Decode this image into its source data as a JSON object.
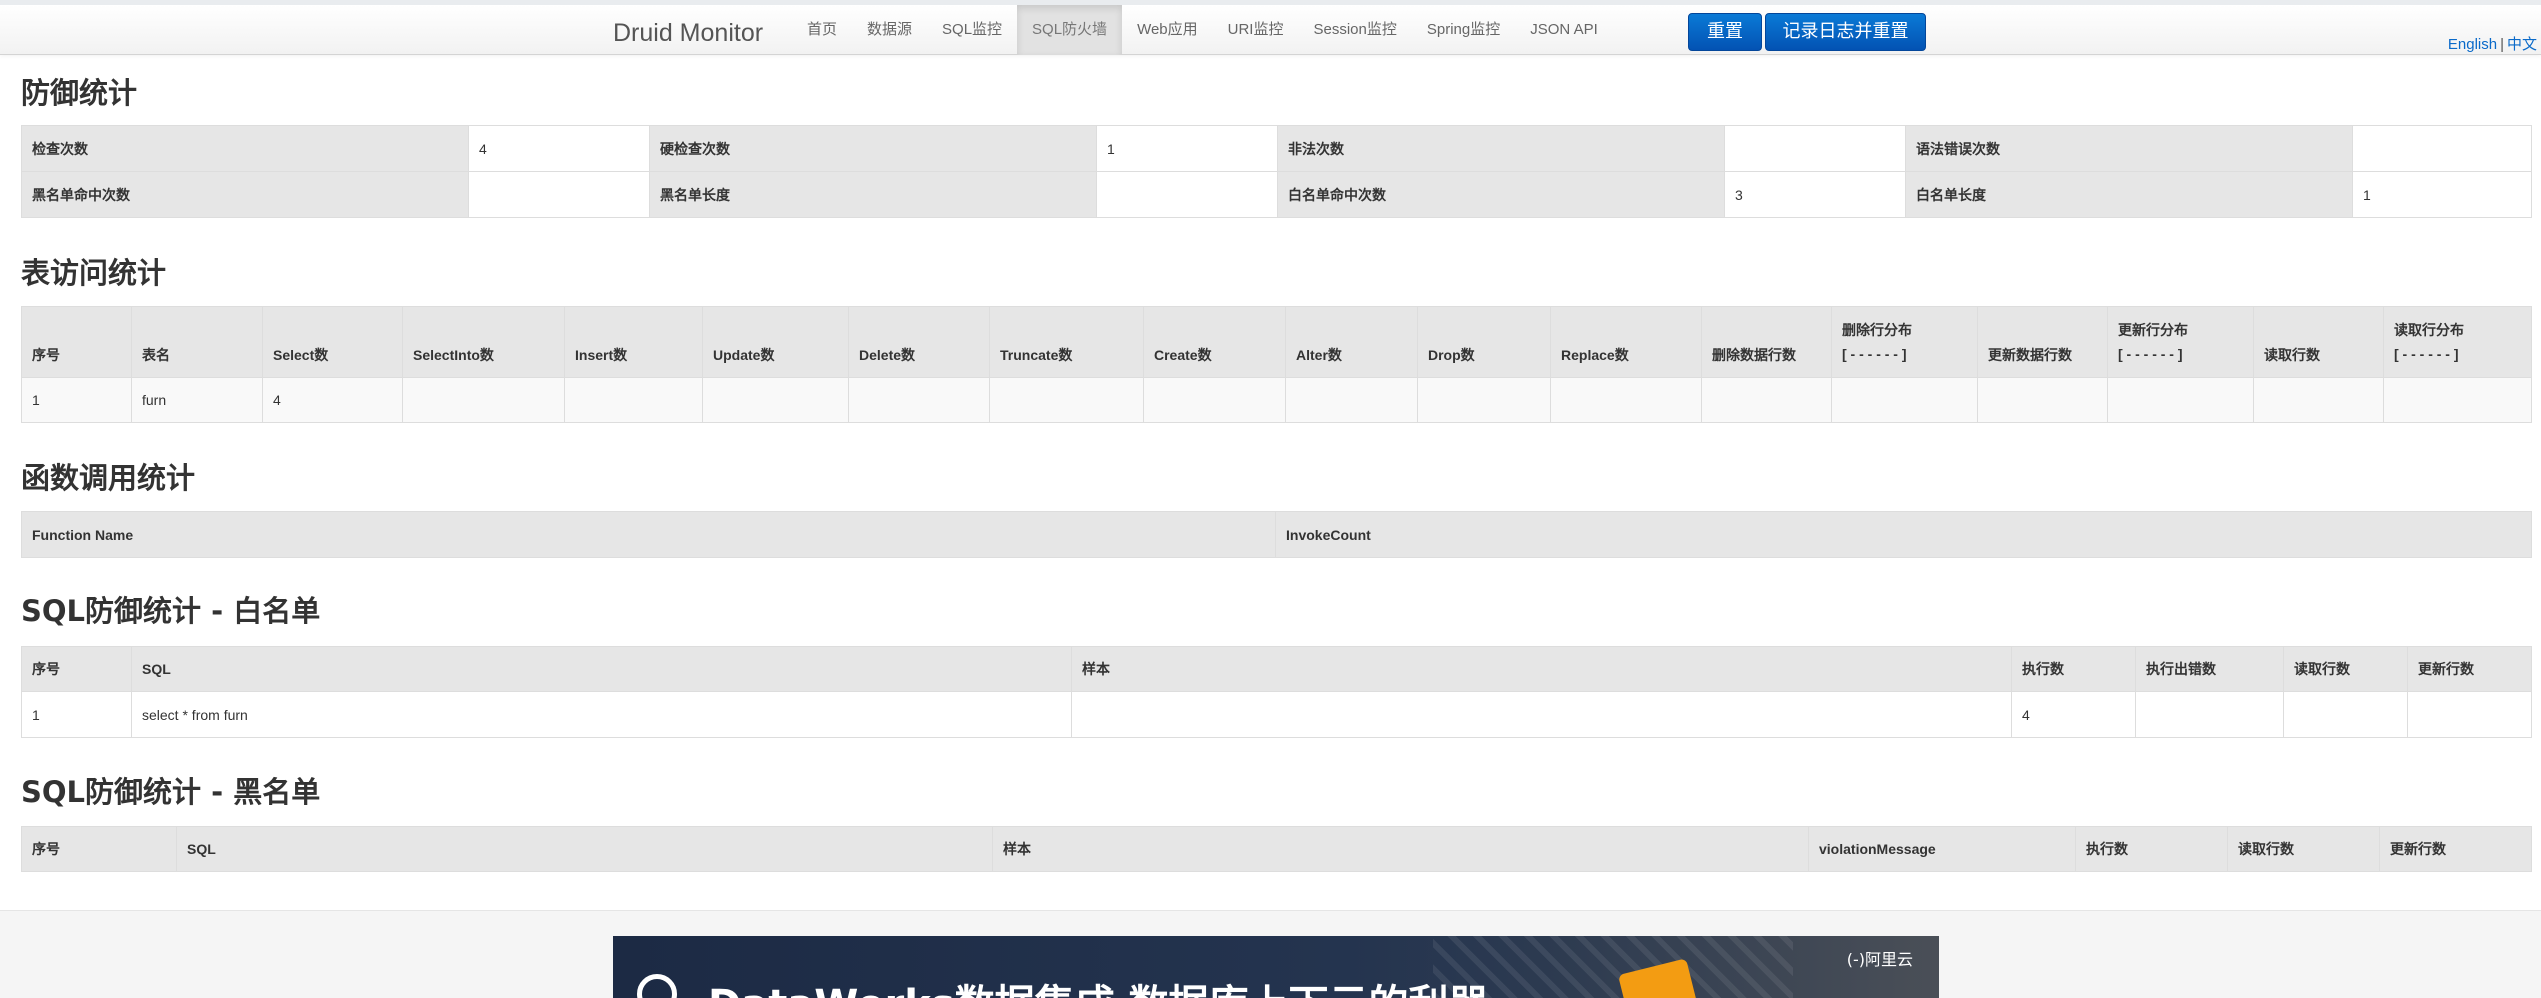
{
  "navbar": {
    "brand": "Druid Monitor",
    "items": [
      {
        "label": "首页"
      },
      {
        "label": "数据源"
      },
      {
        "label": "SQL监控"
      },
      {
        "label": "SQL防火墙"
      },
      {
        "label": "Web应用"
      },
      {
        "label": "URI监控"
      },
      {
        "label": "Session监控"
      },
      {
        "label": "Spring监控"
      },
      {
        "label": "JSON API"
      }
    ],
    "active_item": "SQL防火墙",
    "reset_label": "重置",
    "log_reset_label": "记录日志并重置",
    "lang_en": "English",
    "lang_sep": "|",
    "lang_zh": "中文"
  },
  "defense": {
    "title": "防御统计",
    "rows": [
      [
        {
          "label": "检查次数",
          "value": "4"
        },
        {
          "label": "硬检查次数",
          "value": "1"
        },
        {
          "label": "非法次数",
          "value": ""
        },
        {
          "label": "语法错误次数",
          "value": ""
        }
      ],
      [
        {
          "label": "黑名单命中次数",
          "value": ""
        },
        {
          "label": "黑名单长度",
          "value": ""
        },
        {
          "label": "白名单命中次数",
          "value": "3"
        },
        {
          "label": "白名单长度",
          "value": "1"
        }
      ]
    ]
  },
  "table_access": {
    "title": "表访问统计",
    "headers": [
      "序号",
      "表名",
      "Select数",
      "SelectInto数",
      "Insert数",
      "Update数",
      "Delete数",
      "Truncate数",
      "Create数",
      "Alter数",
      "Drop数",
      "Replace数",
      "删除数据行数",
      "删除行分布",
      "更新数据行数",
      "更新行分布",
      "读取行数",
      "读取行分布"
    ],
    "distribution_placeholder": "[ - - - - - - ]",
    "rows": [
      [
        "1",
        "furn",
        "4",
        "",
        "",
        "",
        "",
        "",
        "",
        "",
        "",
        "",
        "",
        "",
        "",
        "",
        "",
        ""
      ]
    ]
  },
  "functions": {
    "title": "函数调用统计",
    "headers": [
      "Function Name",
      "InvokeCount"
    ]
  },
  "whitelist": {
    "title": "SQL防御统计 - 白名单",
    "headers": [
      "序号",
      "SQL",
      "样本",
      "执行数",
      "执行出错数",
      "读取行数",
      "更新行数"
    ],
    "rows": [
      [
        "1",
        "select * from furn",
        "",
        "4",
        "",
        "",
        ""
      ]
    ]
  },
  "blacklist": {
    "title": "SQL防御统计 - 黑名单",
    "headers": [
      "序号",
      "SQL",
      "样本",
      "violationMessage",
      "执行数",
      "读取行数",
      "更新行数"
    ]
  },
  "banner": {
    "text": "DataWorks数据集成 数据库上下云的利器",
    "brand": "(-)阿里云"
  },
  "colors": {
    "primary_button": "#0352b3",
    "link": "#0a6ac9",
    "header_cell": "#e6e6e6"
  }
}
